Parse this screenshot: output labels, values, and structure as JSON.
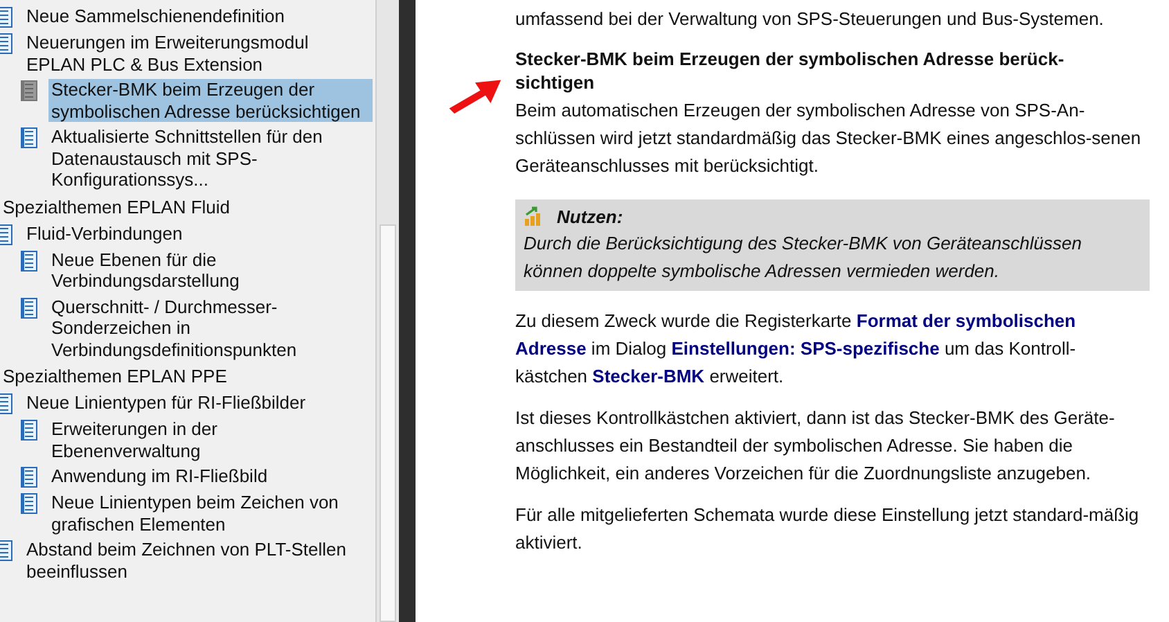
{
  "tree": [
    {
      "kind": "topic",
      "label": "Neue Sammelschienendefinition",
      "selected": false
    },
    {
      "kind": "topic",
      "label": "Neuerungen im Erweiterungsmodul EPLAN PLC & Bus Extension",
      "selected": false,
      "children": [
        {
          "label": "Stecker-BMK beim Erzeugen der symbolischen Adresse berücksichtigen",
          "selected": true
        },
        {
          "label": "Aktualisierte Schnittstellen für den Datenaustausch mit SPS-Konfigurationssys...",
          "selected": false
        }
      ]
    },
    {
      "kind": "heading",
      "label": "Spezialthemen EPLAN Fluid",
      "selected": false
    },
    {
      "kind": "topic",
      "label": "Fluid-Verbindungen",
      "selected": false,
      "children": [
        {
          "label": "Neue Ebenen für die Verbindungsdarstellung",
          "selected": false
        },
        {
          "label": "Querschnitt- / Durchmesser-Sonderzeichen in Verbindungsdefinitionspunkten",
          "selected": false
        }
      ]
    },
    {
      "kind": "heading",
      "label": "Spezialthemen EPLAN PPE",
      "selected": false
    },
    {
      "kind": "topic",
      "label": "Neue Linientypen für RI-Fließbilder",
      "selected": false,
      "children": [
        {
          "label": "Erweiterungen in der Ebenenverwaltung",
          "selected": false
        },
        {
          "label": "Anwendung im RI-Fließbild",
          "selected": false
        },
        {
          "label": "Neue Linientypen beim Zeichen von grafischen Elementen",
          "selected": false
        }
      ]
    },
    {
      "kind": "topic",
      "label": "Abstand beim Zeichnen von PLT-Stellen beeinflussen",
      "selected": false
    }
  ],
  "content": [
    {
      "kind": "paragraph",
      "text": "umfassend bei der Verwaltung von SPS-Steuerungen und Bus-Systemen."
    },
    {
      "kind": "heading",
      "text": "Stecker-BMK beim Erzeugen der symbolischen Adresse berück-sichtigen"
    },
    {
      "kind": "lead",
      "text": "Beim automatischen Erzeugen der symbolischen Adresse von SPS-An-schlüssen wird jetzt standardmäßig das Stecker-BMK eines angeschlos-senen Geräteanschlusses mit berücksichtigt."
    },
    {
      "kind": "note",
      "title": "Nutzen:",
      "text": "Durch die Berücksichtigung des Stecker-BMK von Geräteanschlüssen können doppelte symbolische Adressen vermieden werden."
    },
    {
      "kind": "paragraph",
      "text": "Zu diesem Zweck wurde die Registerkarte **Format der symbolischen Adresse** im Dialog **Einstellungen: SPS-spezifische** um das Kontroll-kästchen **Stecker-BMK** erweitert."
    },
    {
      "kind": "paragraph",
      "text": "Ist dieses Kontrollkästchen aktiviert, dann ist das Stecker-BMK des Geräte-anschlusses ein Bestandteil der symbolischen Adresse. Sie haben die Möglichkeit, ein anderes Vorzeichen für die Zuordnungsliste anzugeben."
    },
    {
      "kind": "paragraph",
      "text": "Für alle mitgelieferten Schemata wurde diese Einstellung jetzt standard-mäßig aktiviert."
    }
  ]
}
